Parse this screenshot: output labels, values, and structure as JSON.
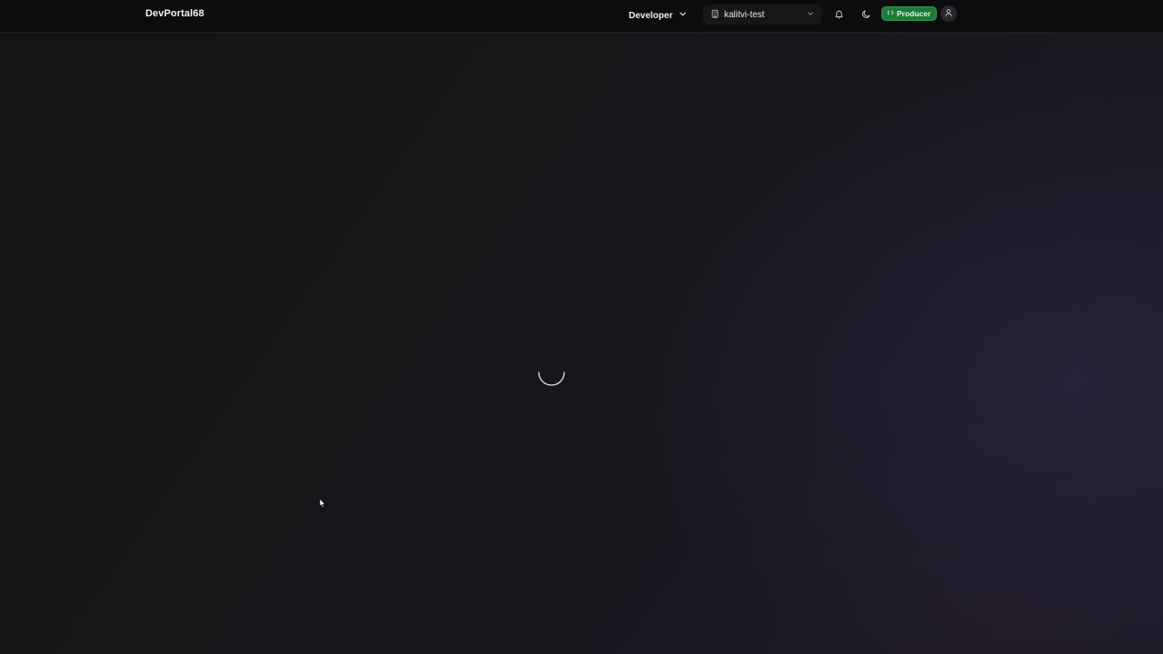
{
  "header": {
    "brand": "DevPortal68",
    "role_selector": {
      "label": "Developer",
      "icon": "chevron-down-icon"
    },
    "org_selector": {
      "label": "kalitvi-test",
      "icon": "building-icon",
      "chevron": "chevron-down-icon"
    },
    "notifications": {
      "icon": "bell-icon"
    },
    "theme_toggle": {
      "icon": "moon-icon"
    },
    "mode_badge": {
      "label": "Producer",
      "icon": "code-icon",
      "color": "#1f7a3a"
    },
    "user_menu": {
      "icon": "user-icon"
    }
  },
  "main": {
    "state": "loading",
    "spinner_icon": "loading-spinner-icon"
  },
  "colors": {
    "background": "#131414",
    "topbar": "#0c0c0d",
    "accent_green": "#1f7a3a",
    "text": "#e8e8ea"
  }
}
